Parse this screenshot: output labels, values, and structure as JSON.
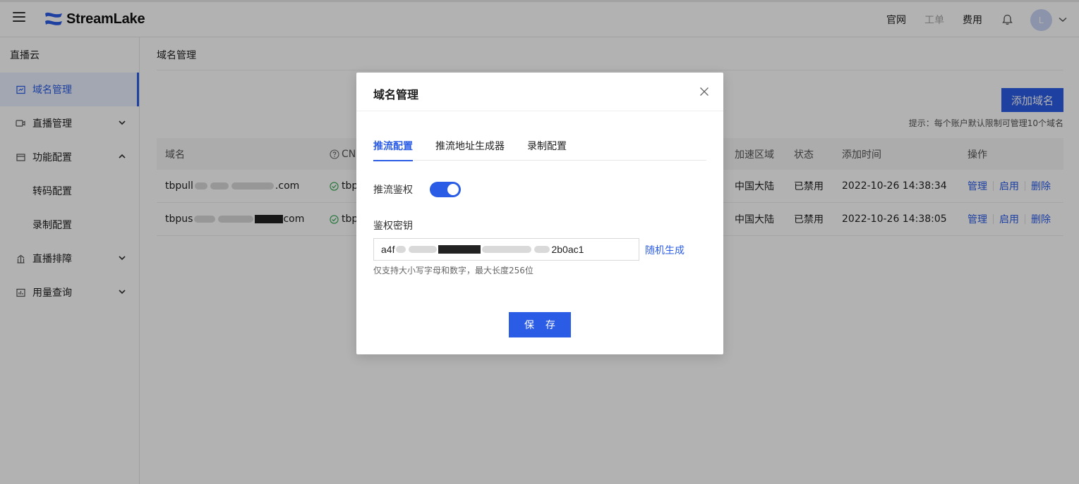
{
  "header": {
    "logo_text": "StreamLake",
    "links": [
      "官网",
      "工单",
      "费用"
    ],
    "avatar_initial": "L"
  },
  "sidebar": {
    "title": "直播云",
    "items": [
      {
        "label": "域名管理",
        "icon": "domain-icon",
        "active": true
      },
      {
        "label": "直播管理",
        "icon": "live-icon",
        "arrow": "down"
      },
      {
        "label": "功能配置",
        "icon": "feature-icon",
        "arrow": "up"
      },
      {
        "label": "转码配置",
        "sub": true
      },
      {
        "label": "录制配置",
        "sub": true
      },
      {
        "label": "直播排障",
        "icon": "troubleshoot-icon",
        "arrow": "down"
      },
      {
        "label": "用量查询",
        "icon": "usage-icon",
        "arrow": "down"
      }
    ]
  },
  "main": {
    "page_title": "域名管理",
    "add_button": "添加域名",
    "hint": "提示：每个账户默认限制可管理10个域名",
    "table": {
      "headers": [
        "域名",
        "CN",
        "加速区域",
        "状态",
        "添加时间",
        "操作"
      ],
      "rows": [
        {
          "domain_prefix": "tbpull",
          "domain_suffix": ".com",
          "cname_prefix": "tbp",
          "region": "中国大陆",
          "status": "已禁用",
          "time": "2022-10-26 14:38:34"
        },
        {
          "domain_prefix": "tbpus",
          "domain_suffix": "com",
          "cname_prefix": "tbp",
          "region": "中国大陆",
          "status": "已禁用",
          "time": "2022-10-26 14:38:05"
        }
      ],
      "ops": [
        "管理",
        "启用",
        "删除"
      ]
    }
  },
  "modal": {
    "title": "域名管理",
    "tabs": [
      "推流配置",
      "推流地址生成器",
      "录制配置"
    ],
    "auth_label": "推流鉴权",
    "auth_enabled": true,
    "key_label": "鉴权密钥",
    "key_prefix": "a4f",
    "key_suffix": "2b0ac1",
    "generate_link": "随机生成",
    "help_text": "仅支持大小写字母和数字，最大长度256位",
    "save_button": "保 存"
  },
  "colors": {
    "accent": "#2b5ce6",
    "overlay": "rgba(0,0,0,0.30)"
  }
}
